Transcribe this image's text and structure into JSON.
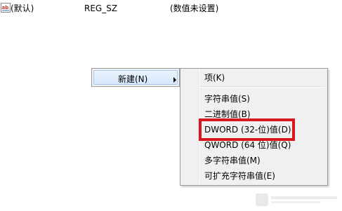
{
  "registry_row": {
    "icon": "reg-string-icon",
    "icon_text": "ab",
    "name": "(默认)",
    "type": "REG_SZ",
    "data": "(数值未设置)"
  },
  "context_menu": {
    "new_label": "新建(N)",
    "submenu_arrow_icon": "chevron-right-icon"
  },
  "submenu": {
    "items": [
      "项(K)",
      "字符串值(S)",
      "二进制值(B)",
      "DWORD (32-位)值(D)",
      "QWORD (64 位)值(Q)",
      "多字符串值(M)",
      "可扩充字符串值(E)"
    ]
  },
  "annotation": {
    "highlight_color": "#d7181f"
  }
}
